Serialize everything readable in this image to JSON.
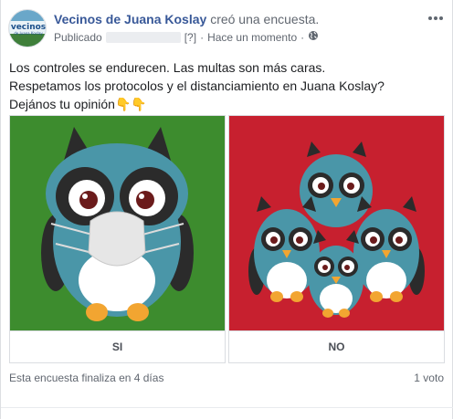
{
  "post": {
    "author": "Vecinos de Juana Koslay",
    "action": "creó una encuesta.",
    "published_label": "Publicado",
    "help_mark": "[?]",
    "separator": "·",
    "timestamp": "Hace un momento",
    "avatar_text_top": "vecinos",
    "avatar_text_bottom": "de Juana Koslay",
    "icons": {
      "privacy": "globe-icon",
      "menu": "more-options-icon"
    }
  },
  "body": {
    "lines": [
      "Los controles se endurecen. Las multas son más caras.",
      "Respetamos los protocolos y el distanciamiento en Juana Koslay?",
      "Dejános tu opinión👇👇"
    ]
  },
  "poll": {
    "options": [
      {
        "label": "SI",
        "background": "#3d8c2e",
        "image": "owl-with-mask"
      },
      {
        "label": "NO",
        "background": "#c7202f",
        "image": "owl-group"
      }
    ],
    "ends_text": "Esta encuesta finaliza en 4 días",
    "votes_text": "1 voto"
  },
  "colors": {
    "link": "#385898",
    "meta": "#616770",
    "owl_body": "#4a96a8"
  }
}
